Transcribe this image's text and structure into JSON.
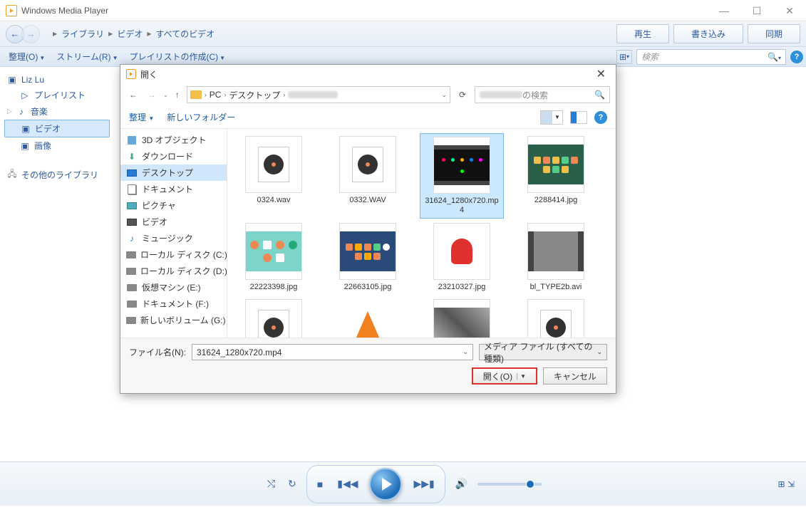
{
  "titlebar": {
    "app_name": "Windows Media Player"
  },
  "navbar": {
    "crumb1": "ライブラリ",
    "crumb2": "ビデオ",
    "crumb3": "すべてのビデオ",
    "tab_play": "再生",
    "tab_burn": "書き込み",
    "tab_sync": "同期"
  },
  "toolbar": {
    "organize": "整理(O)",
    "stream": "ストリーム(R)",
    "create": "プレイリストの作成(C)",
    "search_placeholder": "検索"
  },
  "sidebar": {
    "user": "Liz Lu",
    "playlist": "プレイリスト",
    "music": "音楽",
    "video": "ビデオ",
    "image": "画像",
    "other": "その他のライブラリ"
  },
  "dialog": {
    "title": "開く",
    "path1": "PC",
    "path2": "デスクトップ",
    "search_suffix": "の検索",
    "organize": "整理",
    "newfolder": "新しいフォルダー",
    "tree": {
      "t0": "3D オブジェクト",
      "t1": "ダウンロード",
      "t2": "デスクトップ",
      "t3": "ドキュメント",
      "t4": "ピクチャ",
      "t5": "ビデオ",
      "t6": "ミュージック",
      "t7": "ローカル ディスク (C:)",
      "t8": "ローカル ディスク (D:)",
      "t9": "仮想マシン (E:)",
      "t10": "ドキュメント (F:)",
      "t11": "新しいボリューム (G:)"
    },
    "files": {
      "f0": "0324.wav",
      "f1": "0332.WAV",
      "f2": "31624_1280x720.mp4",
      "f3": "2288414.jpg",
      "f4": "22223398.jpg",
      "f5": "22663105.jpg",
      "f6": "23210327.jpg",
      "f7": "bl_TYPE2b.avi"
    },
    "filename_label": "ファイル名(N):",
    "filename_value": "31624_1280x720.mp4",
    "filter": "メディア ファイル (すべての種類)",
    "open_btn": "開く(O)",
    "cancel_btn": "キャンセル"
  }
}
